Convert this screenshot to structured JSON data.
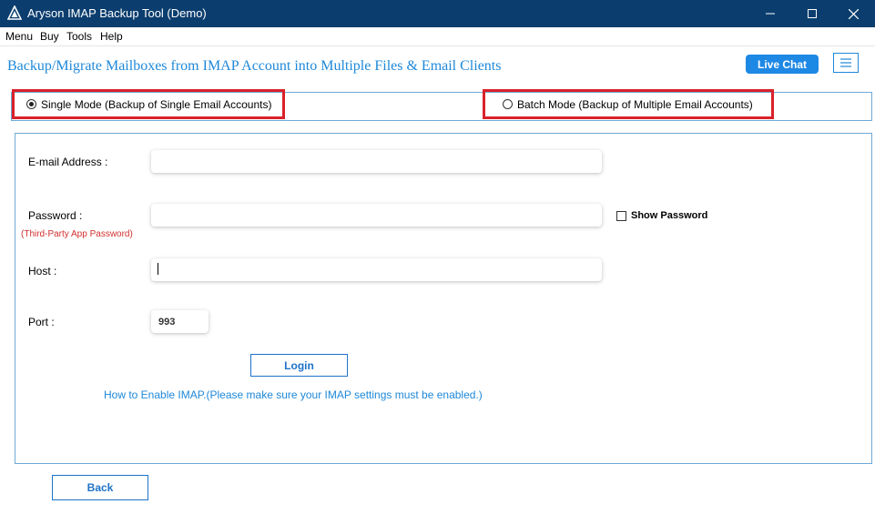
{
  "window": {
    "title": "Aryson IMAP Backup Tool (Demo)",
    "controls": [
      "minimize",
      "maximize",
      "close"
    ]
  },
  "menubar": {
    "items": [
      "Menu",
      "Buy",
      "Tools",
      "Help"
    ]
  },
  "header": {
    "heading": "Backup/Migrate Mailboxes from IMAP Account into Multiple Files & Email Clients",
    "live_chat": "Live Chat",
    "menu_icon": "hamburger-icon"
  },
  "modes": {
    "single": {
      "label": "Single Mode (Backup of Single Email Accounts)",
      "selected": true
    },
    "batch": {
      "label": "Batch Mode (Backup of Multiple Email Accounts)",
      "selected": false
    }
  },
  "form": {
    "email_label": "E-mail Address :",
    "email_value": "",
    "password_label": "Password :",
    "password_hint": "(Third-Party App Password)",
    "password_value": "",
    "show_password_label": "Show Password",
    "show_password_checked": false,
    "host_label": "Host :",
    "host_value": "",
    "port_label": "Port :",
    "port_value": "993",
    "login_button": "Login",
    "imap_help_link": "How to Enable IMAP.(Please make sure your IMAP settings must be enabled.)"
  },
  "footer": {
    "back_button": "Back"
  },
  "colors": {
    "titlebar": "#0b3e6e",
    "accent": "#1e88d9",
    "highlight_border": "#d9212a",
    "hint_text": "#d32f2f"
  }
}
